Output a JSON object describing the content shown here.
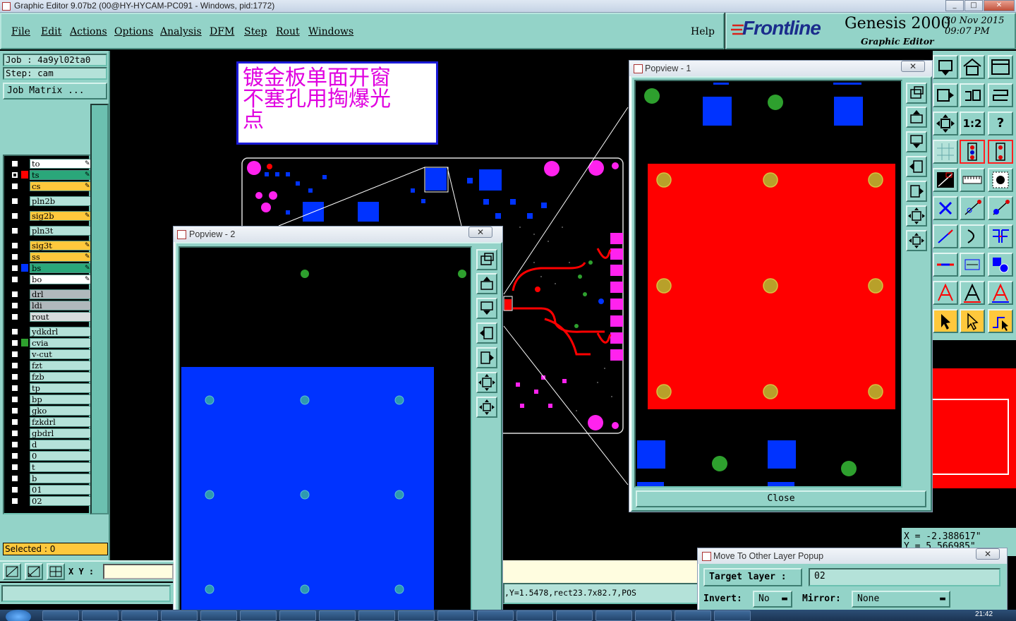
{
  "window": {
    "title": "Graphic Editor 9.07b2 (00@HY-HYCAM-PC091 - Windows, pid:1772)"
  },
  "menu": {
    "items": [
      "File",
      "Edit",
      "Actions",
      "Options",
      "Analysis",
      "DFM",
      "Step",
      "Rout",
      "Windows"
    ],
    "help": "Help"
  },
  "brand": {
    "logo": "Frontline",
    "product": "Genesis 2000",
    "subtitle": "Graphic Editor",
    "date": "30 Nov 2015",
    "time": "09:07 PM"
  },
  "job": {
    "job_label": "Job : 4a9yl02ta0",
    "step_label": "Step: cam",
    "matrix_button": "Job Matrix ..."
  },
  "layers": [
    {
      "name": "to",
      "bg": "#ffffff",
      "color": "",
      "checked": false,
      "pen": true
    },
    {
      "name": "ts",
      "bg": "#2aa77a",
      "color": "#ff0000",
      "checked": true,
      "pen": true
    },
    {
      "name": "cs",
      "bg": "#ffc83c",
      "color": "",
      "checked": false,
      "pen": true
    },
    {
      "name": "pln2b",
      "bg": "#b4e2d9",
      "color": "",
      "checked": false,
      "pen": false
    },
    {
      "name": "sig2b",
      "bg": "#ffc83c",
      "color": "",
      "checked": false,
      "pen": true
    },
    {
      "name": "pln3t",
      "bg": "#b4e2d9",
      "color": "",
      "checked": false,
      "pen": false
    },
    {
      "name": "sig3t",
      "bg": "#ffc83c",
      "color": "",
      "checked": false,
      "pen": true
    },
    {
      "name": "ss",
      "bg": "#ffc83c",
      "color": "",
      "checked": false,
      "pen": true
    },
    {
      "name": "bs",
      "bg": "#2aa77a",
      "color": "#0033ff",
      "checked": false,
      "pen": true
    },
    {
      "name": "bo",
      "bg": "#ffffff",
      "color": "",
      "checked": false,
      "pen": true
    },
    {
      "name": "drl",
      "bg": "#b0b8bc",
      "color": "",
      "checked": false,
      "pen": false
    },
    {
      "name": "ldi",
      "bg": "#b0b8bc",
      "color": "",
      "checked": false,
      "pen": false
    },
    {
      "name": "rout",
      "bg": "#d8dcdc",
      "color": "",
      "checked": false,
      "pen": false
    },
    {
      "name": "ydkdrl",
      "bg": "#b4e2d9",
      "color": "",
      "checked": false,
      "pen": false
    },
    {
      "name": "cvia",
      "bg": "#b4e2d9",
      "color": "#2ea02e",
      "checked": false,
      "pen": false
    },
    {
      "name": "v-cut",
      "bg": "#b4e2d9",
      "color": "",
      "checked": false,
      "pen": false
    },
    {
      "name": "fzt",
      "bg": "#b4e2d9",
      "color": "",
      "checked": false,
      "pen": false
    },
    {
      "name": "fzb",
      "bg": "#b4e2d9",
      "color": "",
      "checked": false,
      "pen": false
    },
    {
      "name": "tp",
      "bg": "#b4e2d9",
      "color": "",
      "checked": false,
      "pen": false
    },
    {
      "name": "bp",
      "bg": "#b4e2d9",
      "color": "",
      "checked": false,
      "pen": false
    },
    {
      "name": "gko",
      "bg": "#b4e2d9",
      "color": "",
      "checked": false,
      "pen": false
    },
    {
      "name": "fzkdrl",
      "bg": "#b4e2d9",
      "color": "",
      "checked": false,
      "pen": false
    },
    {
      "name": "gbdrl",
      "bg": "#b4e2d9",
      "color": "",
      "checked": false,
      "pen": false
    },
    {
      "name": "d",
      "bg": "#b4e2d9",
      "color": "",
      "checked": false,
      "pen": false
    },
    {
      "name": "0",
      "bg": "#b4e2d9",
      "color": "",
      "checked": false,
      "pen": false
    },
    {
      "name": "t",
      "bg": "#b4e2d9",
      "color": "",
      "checked": false,
      "pen": false
    },
    {
      "name": "b",
      "bg": "#b4e2d9",
      "color": "",
      "checked": false,
      "pen": false
    },
    {
      "name": "01",
      "bg": "#b4e2d9",
      "color": "",
      "checked": false,
      "pen": false
    },
    {
      "name": "02",
      "bg": "#b4e2d9",
      "color": "",
      "checked": false,
      "pen": false
    }
  ],
  "selected": "Selected : 0",
  "xy_label": "X Y :",
  "xy_value": "",
  "status_bar": ",Y=1.5478,rect23.7x82.7,POS",
  "coords": {
    "x": "X = -2.388617\"",
    "y": "Y = 5.566985\""
  },
  "annotation": {
    "lines": [
      "镀金板单面开窗",
      "不塞孔用掏爆光",
      "点"
    ]
  },
  "popview1": {
    "title": "Popview - 1",
    "close_label": "Close"
  },
  "popview2": {
    "title": "Popview - 2"
  },
  "move_popup": {
    "title": "Move To Other Layer Popup",
    "target_label": "Target layer :",
    "target_value": "02",
    "invert_label": "Invert:",
    "invert_value": "No",
    "mirror_label": "Mirror:",
    "mirror_value": "None"
  },
  "taskbar": {
    "time": "21:42"
  },
  "colors": {
    "panel": "#93d3c8",
    "copper_red": "#ff0000",
    "mask_blue": "#0033ff",
    "pad_magenta": "#ff22ee",
    "via_green": "#2ea02e"
  }
}
